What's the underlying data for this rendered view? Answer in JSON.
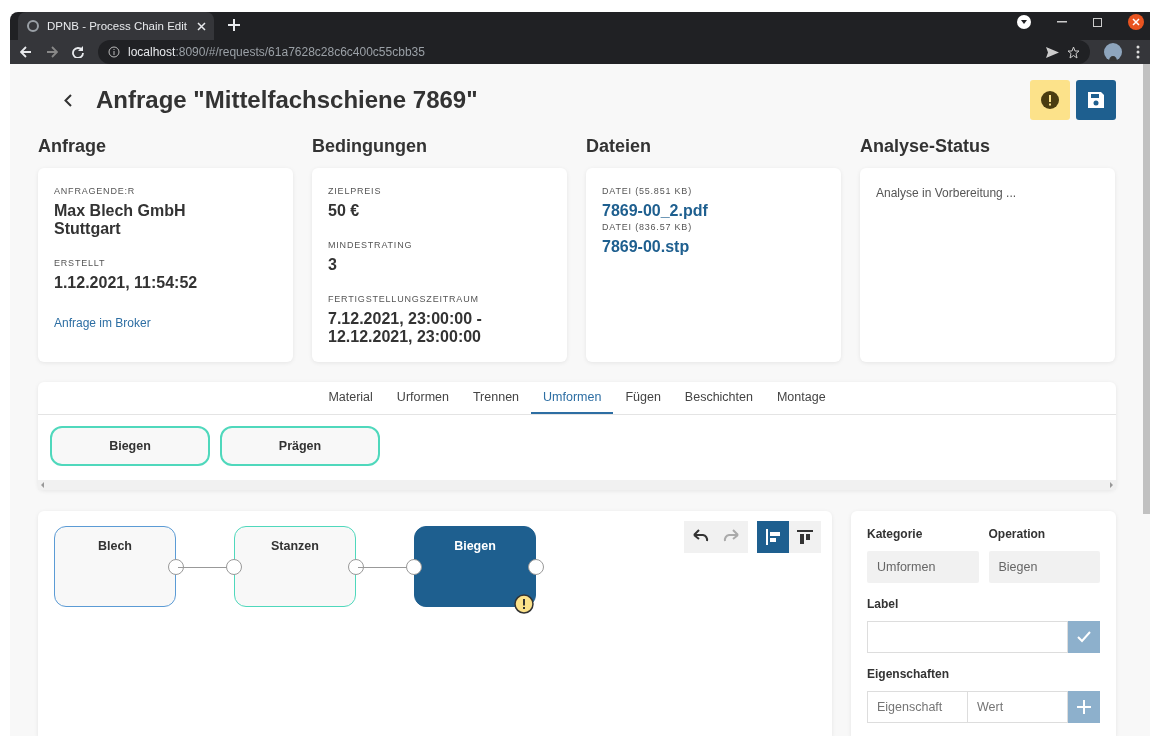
{
  "browser": {
    "tab_title": "DPNB - Process Chain Edit",
    "url_host": "localhost",
    "url_rest": ":8090/#/requests/61a7628c28c6c400c55cbb35"
  },
  "page": {
    "title": "Anfrage \"Mittelfachschiene 7869\""
  },
  "sections": [
    {
      "title": "Anfrage",
      "items": [
        {
          "kind": "label",
          "text": "ANFRAGENDE:R"
        },
        {
          "kind": "value",
          "lines": [
            "Max Blech GmbH",
            "Stuttgart"
          ]
        },
        {
          "kind": "label",
          "text": "ERSTELLT"
        },
        {
          "kind": "value",
          "lines": [
            "1.12.2021, 11:54:52"
          ]
        },
        {
          "kind": "link",
          "text": "Anfrage im Broker"
        }
      ]
    },
    {
      "title": "Bedingungen",
      "items": [
        {
          "kind": "label",
          "text": "ZIELPREIS"
        },
        {
          "kind": "value",
          "lines": [
            "50 €"
          ]
        },
        {
          "kind": "label",
          "text": "MINDESTRATING"
        },
        {
          "kind": "value",
          "lines": [
            "3"
          ]
        },
        {
          "kind": "label",
          "text": "FERTIGSTELLUNGSZEITRAUM"
        },
        {
          "kind": "value",
          "lines": [
            "7.12.2021, 23:00:00 -",
            "12.12.2021, 23:00:00"
          ]
        }
      ]
    },
    {
      "title": "Dateien",
      "items": [
        {
          "kind": "file",
          "label": "DATEI (55.851 KB)",
          "name": "7869-00_2.pdf"
        },
        {
          "kind": "file",
          "label": "DATEI (836.57 KB)",
          "name": "7869-00.stp"
        }
      ]
    },
    {
      "title": "Analyse-Status",
      "items": [
        {
          "kind": "text",
          "text": "Analyse in Vorbereitung ..."
        }
      ]
    }
  ],
  "categories": [
    {
      "label": "Material",
      "selected": false
    },
    {
      "label": "Urformen",
      "selected": false
    },
    {
      "label": "Trennen",
      "selected": false
    },
    {
      "label": "Umformen",
      "selected": true
    },
    {
      "label": "Fügen",
      "selected": false
    },
    {
      "label": "Beschichten",
      "selected": false
    },
    {
      "label": "Montage",
      "selected": false
    }
  ],
  "operations": [
    "Biegen",
    "Prägen"
  ],
  "toolbar": [
    {
      "kind": "undo",
      "disabled": false,
      "selected": false
    },
    {
      "kind": "redo",
      "disabled": true,
      "selected": false
    },
    {
      "kind": "align-left",
      "disabled": false,
      "selected": true
    },
    {
      "kind": "align-top",
      "disabled": false,
      "selected": false
    }
  ],
  "nodes": [
    {
      "label": "Blech",
      "color": "#5b9bd5",
      "selected": false,
      "warning": false
    },
    {
      "label": "Stanzen",
      "color": "#4fd8bc",
      "selected": false,
      "warning": false
    },
    {
      "label": "Biegen",
      "color": "#1e5f8f",
      "selected": true,
      "warning": true
    }
  ],
  "properties": {
    "kategorie_label": "Kategorie",
    "kategorie_value": "Umformen",
    "operation_label": "Operation",
    "operation_value": "Biegen",
    "label_label": "Label",
    "eigenschaften_label": "Eigenschaften",
    "eigenschaft_placeholder": "Eigenschaft",
    "wert_placeholder": "Wert"
  }
}
